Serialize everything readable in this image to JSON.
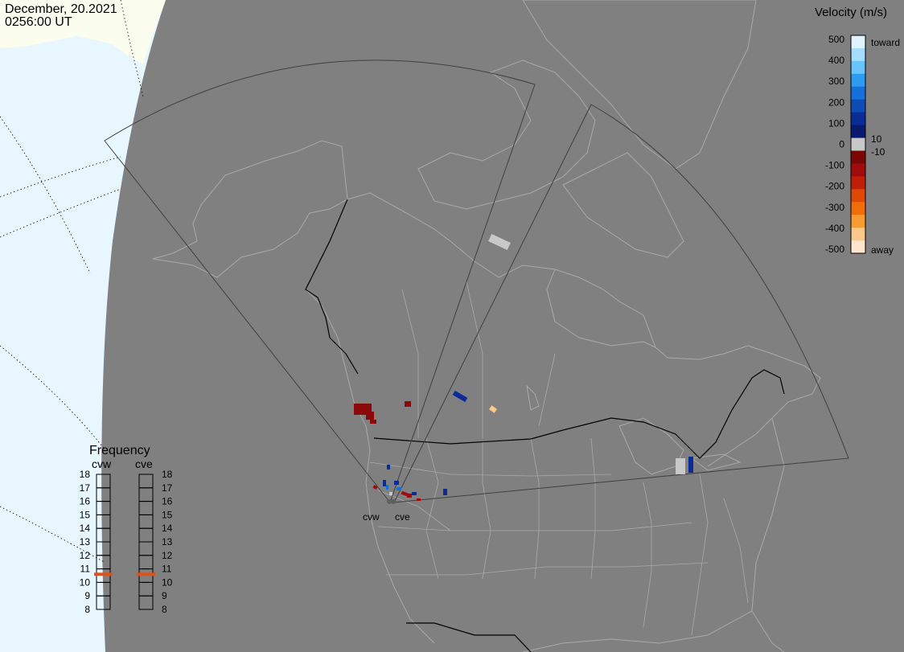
{
  "header": {
    "date": "December, 20.2021",
    "time": "0256:00 UT"
  },
  "colors": {
    "map_gray": "#808080",
    "space": "#e8f7ff",
    "land_light": "#fbfdee",
    "land_border": "#a9a9a9",
    "fov_outline": "#404040",
    "freq_marker": "#e05018"
  },
  "velocity_scale": {
    "title": "Velocity (m/s)",
    "ticks": [
      "500",
      "400",
      "300",
      "200",
      "100",
      "0",
      "-100",
      "-200",
      "-300",
      "-400",
      "-500"
    ],
    "near_zero_labels": [
      "10",
      "-10"
    ],
    "toward_label": "toward",
    "away_label": "away",
    "palette": [
      "#e0f4ff",
      "#a6dcff",
      "#68c4ff",
      "#2c9cf0",
      "#1670dc",
      "#0c4cb4",
      "#0a2c96",
      "#081a6c",
      "#c8c8c8",
      "#7a0606",
      "#9e0c0c",
      "#c01e06",
      "#de4a06",
      "#f06e0a",
      "#f89c32",
      "#fcc88c",
      "#ffe6cc"
    ]
  },
  "frequency": {
    "title": "Frequency",
    "radars": [
      {
        "name": "cvw",
        "frequency_mhz": 10.6
      },
      {
        "name": "cve",
        "frequency_mhz": 10.6
      }
    ],
    "ticks": [
      "18",
      "17",
      "16",
      "15",
      "14",
      "13",
      "12",
      "11",
      "10",
      "9",
      "8"
    ]
  },
  "map": {
    "radar_site_labels": [
      "cvw",
      "cve"
    ]
  }
}
